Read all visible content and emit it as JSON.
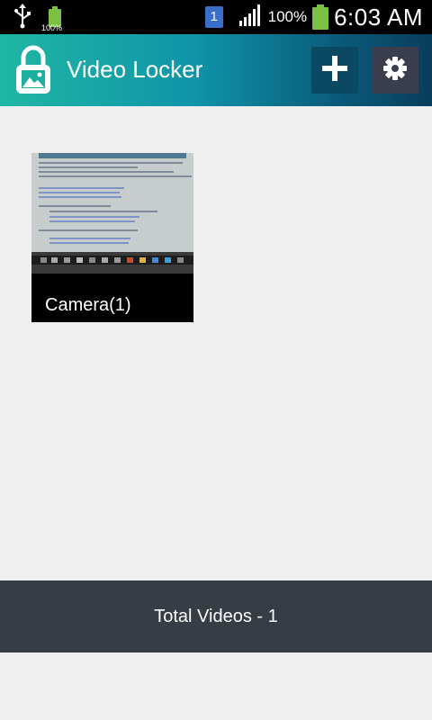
{
  "status_bar": {
    "battery_small_label": "100%",
    "notification_count": "1",
    "battery_percent": "100%",
    "time": "6:03 AM"
  },
  "action_bar": {
    "title": "Video Locker",
    "icons": {
      "app": "lock-image-icon",
      "add": "plus-icon",
      "settings": "gear-icon"
    }
  },
  "folders": [
    {
      "name": "Camera(1)"
    }
  ],
  "footer": {
    "total_label": "Total Videos - 1"
  },
  "colors": {
    "action_bar_start": "#1fb7a4",
    "action_bar_end": "#0a3d5c",
    "footer_bg": "#373d45",
    "battery": "#7ac142"
  }
}
